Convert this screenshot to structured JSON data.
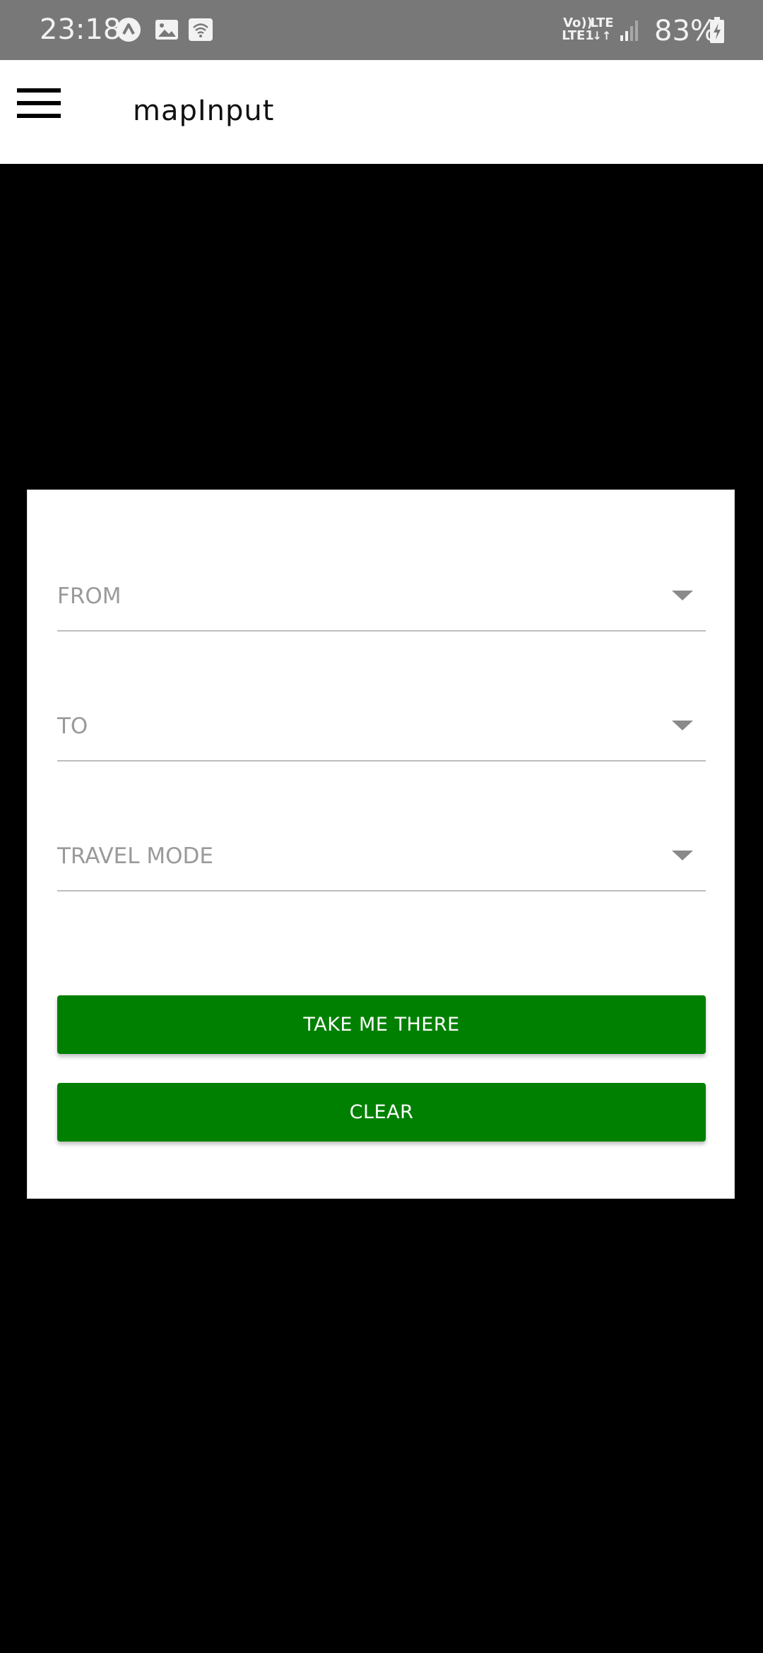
{
  "status_bar": {
    "time": "23:18",
    "network_top": "Vo))",
    "network_bottom": "LTE1",
    "lte_label": "LTE",
    "battery": "83%",
    "icons": [
      "app-notification-icon",
      "image-icon",
      "wifi-hotspot-icon",
      "signal-icon",
      "battery-charging-icon"
    ]
  },
  "app_bar": {
    "title": "mapInput",
    "menu_icon": "hamburger-menu-icon"
  },
  "form": {
    "from_label": "FROM",
    "to_label": "TO",
    "travel_mode_label": "TRAVEL MODE",
    "take_me_there_label": "TAKE ME THERE",
    "clear_label": "CLEAR"
  },
  "colors": {
    "status_bar": "#787878",
    "app_bar": "#ffffff",
    "background": "#000000",
    "button": "#008000",
    "button_text": "#ffffff",
    "field_label": "#9a9a9a"
  }
}
